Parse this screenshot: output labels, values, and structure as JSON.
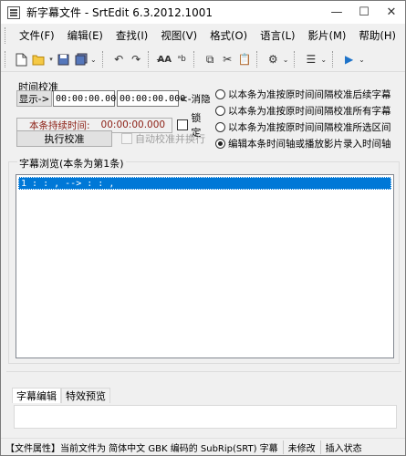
{
  "window": {
    "title": "新字幕文件 - SrtEdit 6.3.2012.1001"
  },
  "window_buttons": {
    "minimize": "—",
    "maximize": "☐",
    "close": "✕"
  },
  "menu": {
    "items": [
      {
        "label": "文件(F)"
      },
      {
        "label": "编辑(E)"
      },
      {
        "label": "查找(I)"
      },
      {
        "label": "视图(V)"
      },
      {
        "label": "格式(O)"
      },
      {
        "label": "语言(L)"
      },
      {
        "label": "影片(M)"
      },
      {
        "label": "帮助(H)"
      }
    ]
  },
  "toolbar": {
    "icons": [
      "new-file-icon",
      "open-folder-icon",
      "save-icon",
      "save-all-icon",
      "undo-icon",
      "redo-icon",
      "find-icon",
      "replace-icon",
      "copy-icon",
      "cut-icon",
      "paste-icon",
      "settings-icon",
      "list-icon",
      "play-icon"
    ]
  },
  "calibration": {
    "title": "时间校准",
    "display_label": "显示->",
    "start_time": "00:00:00.000",
    "end_time": "00:00:00.000",
    "cancel_label": "<-消隐",
    "duration_label": "本条持续时间:",
    "duration_value": "00:00:00.000",
    "lock_label": "锁定",
    "run_label": "执行校准",
    "auto_label": "自动校准并换行"
  },
  "options": [
    {
      "label": "以本条为准按原时间间隔校准后续字幕",
      "checked": false
    },
    {
      "label": "以本条为准按原时间间隔校准所有字幕",
      "checked": false
    },
    {
      "label": "以本条为准按原时间间隔校准所选区间",
      "checked": false
    },
    {
      "label": "编辑本条时间轴或播放影片录入时间轴",
      "checked": true
    }
  ],
  "browse": {
    "title": "字幕浏览(本条为第1条)",
    "rows": [
      {
        "text": "1  :  :  ,   -->  :  :  ,"
      }
    ]
  },
  "bottom_tabs": [
    {
      "label": "字幕编辑"
    },
    {
      "label": "特效预览"
    }
  ],
  "status": {
    "file_info": "【文件属性】当前文件为 简体中文 GBK 编码的 SubRip(SRT) 字幕",
    "modified": "未修改",
    "mode": "插入状态"
  },
  "colors": {
    "selection": "#0078d7",
    "duration_text": "#8b1d12"
  }
}
